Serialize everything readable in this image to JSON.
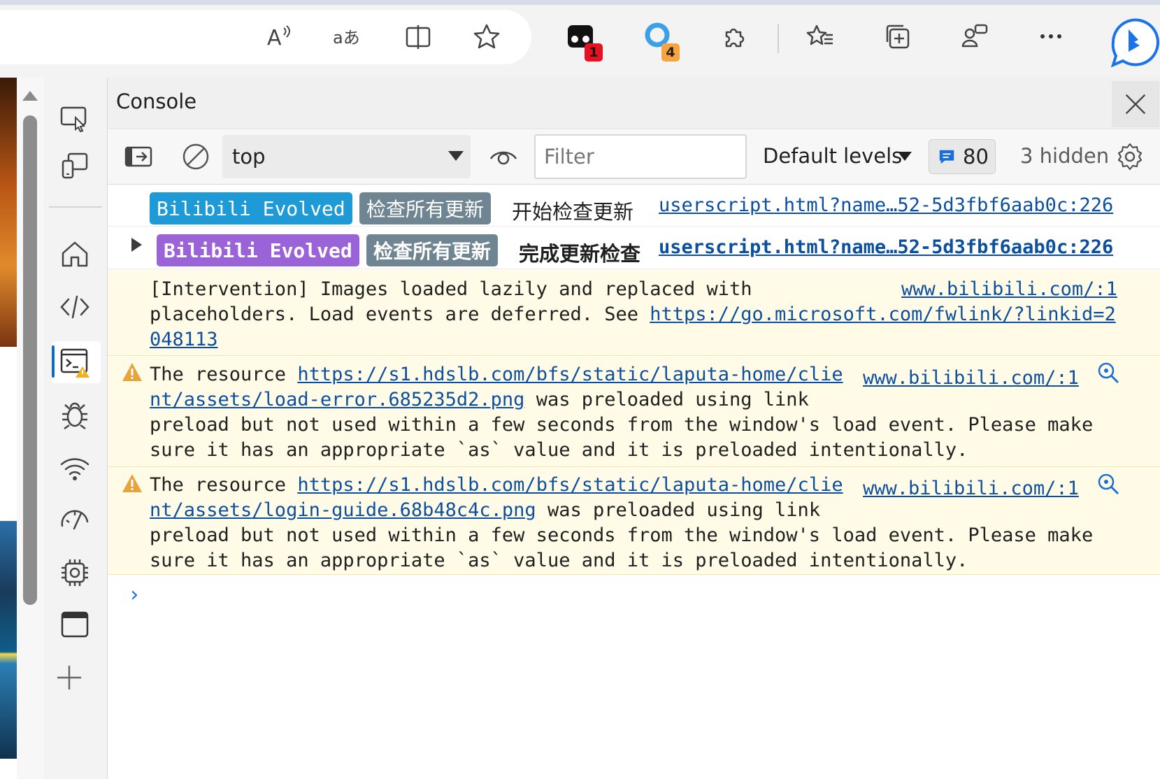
{
  "browser_toolbar": {
    "icons": [
      "read-aloud-icon",
      "translate-icon",
      "split-screen-icon",
      "favorite-star-icon",
      "extension-icon",
      "extension-icon",
      "extensions-puzzle-icon",
      "favorites-list-icon",
      "collections-icon",
      "profile-feedback-icon",
      "more-icon",
      "bing-copilot-icon"
    ],
    "extension_badges": {
      "first": "1",
      "second": "4"
    },
    "colors": {
      "badge_red": "#e81123",
      "badge_orange": "#f7a440",
      "bing_blue": "#1a73e8"
    }
  },
  "devtools": {
    "panel_title": "Console",
    "activity_icons": [
      "inspect-icon",
      "device-emulation-icon",
      "welcome-home-icon",
      "elements-icon",
      "console-icon",
      "sources-bug-icon",
      "network-wifi-icon",
      "performance-icon",
      "memory-chip-icon",
      "application-icon",
      "more-tools-plus-icon"
    ],
    "console_toolbar": {
      "context": "top",
      "filter_placeholder": "Filter",
      "levels_label": "Default levels",
      "message_count": "80",
      "hidden_label": "3 hidden"
    },
    "messages": [
      {
        "type": "info",
        "tag1": "Bilibili Evolved",
        "tag2": "检查所有更新",
        "text": "开始检查更新",
        "source": "userscript.html?name…52-5d3fbf6aab0c:226"
      },
      {
        "type": "group",
        "tag1": "Bilibili Evolved",
        "tag2": "检查所有更新",
        "text": "完成更新检查",
        "source": "userscript.html?name…52-5d3fbf6aab0c:226"
      },
      {
        "type": "intervention",
        "line1": "[Intervention] Images loaded lazily and replaced with",
        "line2_text": "placeholders. Load events are deferred. See ",
        "line2_link": "https://go.microsoft.com/fwlink/?linkid=2",
        "line3_link": "048113",
        "source": "www.bilibili.com/:1"
      },
      {
        "type": "warning",
        "prefix": "The resource ",
        "link_a": "https://s1.hdslb.com/bfs/static/laputa-home/clie",
        "link_b": "nt/assets/load-error.685235d2.png",
        "after_link": " was preloaded using link",
        "line3": "preload but not used within a few seconds from the window's load event. Please make",
        "line4": "sure it has an appropriate `as` value and it is preloaded intentionally.",
        "source": "www.bilibili.com/:1"
      },
      {
        "type": "warning",
        "prefix": "The resource ",
        "link_a": "https://s1.hdslb.com/bfs/static/laputa-home/clie",
        "link_b": "nt/assets/login-guide.68b48c4c.png",
        "after_link": " was preloaded using link",
        "line3": "preload but not used within a few seconds from the window's load event. Please make",
        "line4": "sure it has an appropriate `as` value and it is preloaded intentionally.",
        "source": "www.bilibili.com/:1"
      }
    ],
    "prompt_symbol": "›"
  }
}
